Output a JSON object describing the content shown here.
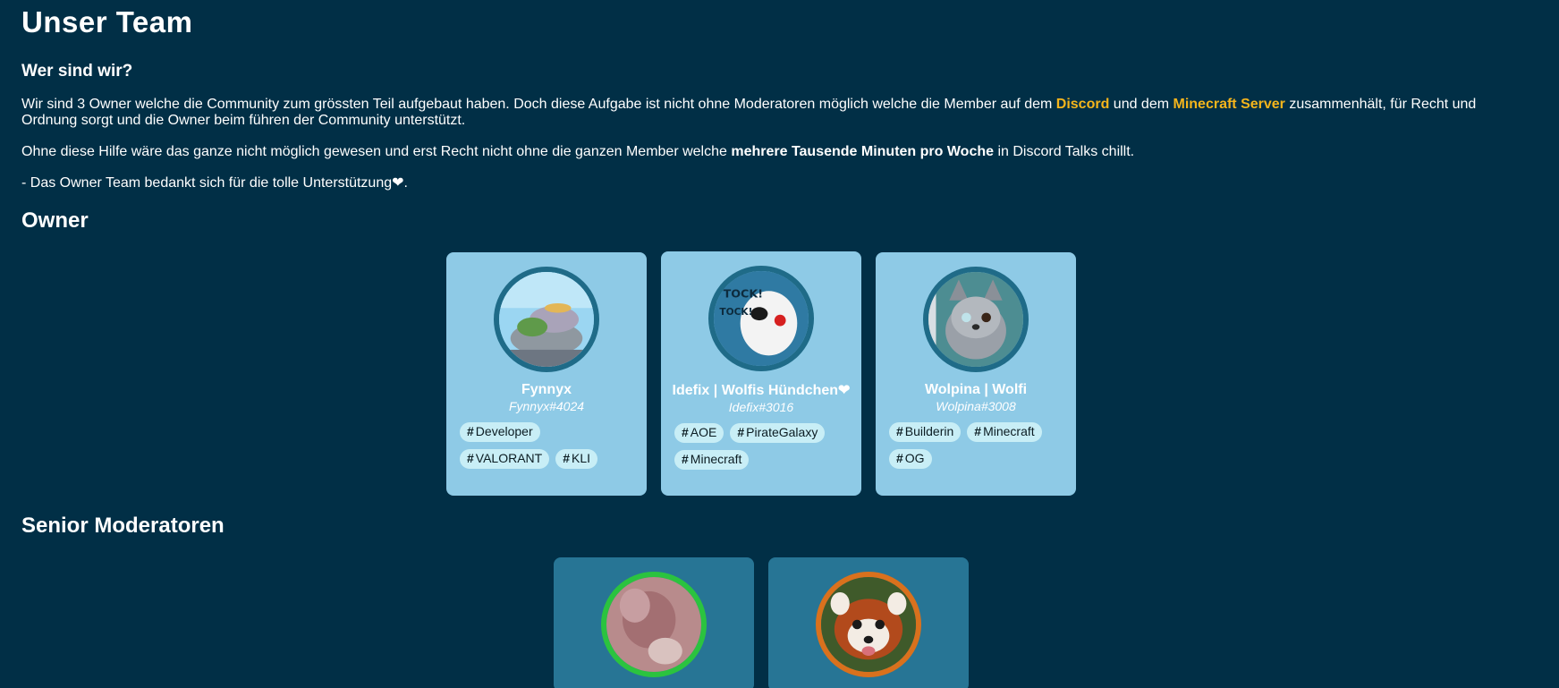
{
  "header": {
    "title": "Unser Team",
    "subtitle": "Wer sind wir?"
  },
  "about": {
    "p1_a": "Wir sind 3 Owner welche die Community zum grössten Teil aufgebaut haben. Doch diese Aufgabe ist nicht ohne Moderatoren möglich welche die Member auf dem ",
    "discord": "Discord",
    "p1_b": " und dem ",
    "minecraft": "Minecraft Server",
    "p1_c": " zusammenhält, für Recht und Ordnung sorgt und die Owner beim führen der Community unterstützt.",
    "p2_a": "Ohne diese Hilfe wäre das ganze nicht möglich gewesen und erst Recht nicht ohne die ganzen Member welche ",
    "p2_bold": "mehrere Tausende Minuten pro Woche",
    "p2_b": " in Discord Talks chillt.",
    "p3": "- Das Owner Team bedankt sich für die tolle Unterstützung❤."
  },
  "sections": {
    "owner": "Owner",
    "senior": "Senior Moderatoren"
  },
  "owners": [
    {
      "name": "Fynnyx",
      "tag": "Fynnyx#4024",
      "ring_color": "#1f6b88",
      "tags": [
        "Developer",
        "VALORANT",
        "KLI"
      ]
    },
    {
      "name": "Idefix | Wolfis Hündchen❤",
      "tag": "Idefix#3016",
      "ring_color": "#1f6b88",
      "tags": [
        "AOE",
        "PirateGalaxy",
        "Minecraft"
      ]
    },
    {
      "name": "Wolpina | Wolfi",
      "tag": "Wolpina#3008",
      "ring_color": "#1f6b88",
      "tags": [
        "Builderin",
        "Minecraft",
        "OG"
      ]
    }
  ],
  "seniors": [
    {
      "ring_color": "#2bc33f"
    },
    {
      "ring_color": "#d9711d"
    }
  ],
  "colors": {
    "background": "#012f46",
    "owner_card": "#8ecae6",
    "senior_card": "#277595",
    "highlight": "#f5b51c",
    "tag_bg": "#c8eef6"
  }
}
